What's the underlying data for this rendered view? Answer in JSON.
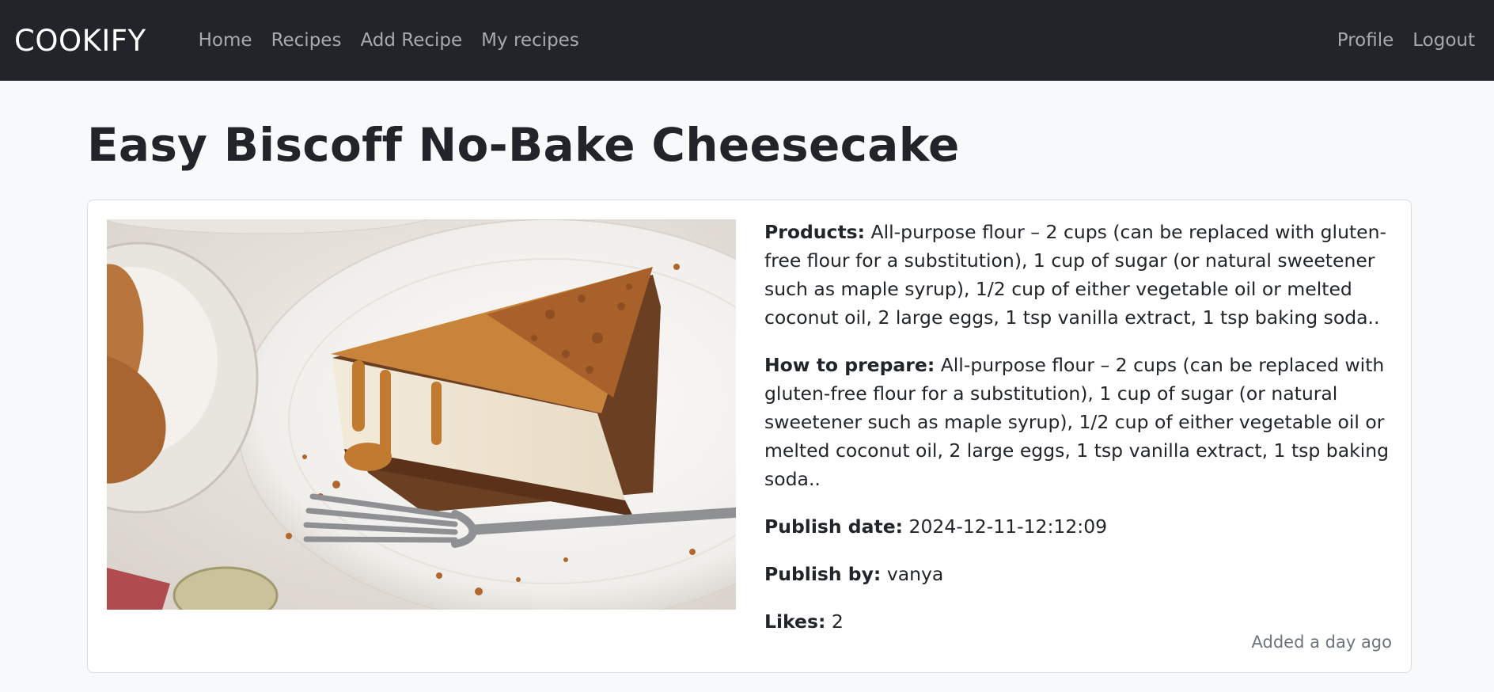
{
  "nav": {
    "brand": "COOKIFY",
    "links": [
      "Home",
      "Recipes",
      "Add Recipe",
      "My recipes"
    ],
    "right_links": [
      "Profile",
      "Logout"
    ]
  },
  "recipe": {
    "title": "Easy Biscoff No-Bake Cheesecake",
    "image_alt": "Slice of Biscoff cheesecake on a plate with a fork",
    "products_label": "Products:",
    "products": "All-purpose flour – 2 cups (can be replaced with gluten-free flour for a substitution), 1 cup of sugar (or natural sweetener such as maple syrup), 1/2 cup of either vegetable oil or melted coconut oil, 2 large eggs, 1 tsp vanilla extract, 1 tsp baking soda..",
    "prepare_label": "How to prepare:",
    "prepare": "All-purpose flour – 2 cups (can be replaced with gluten-free flour for a substitution), 1 cup of sugar (or natural sweetener such as maple syrup), 1/2 cup of either vegetable oil or melted coconut oil, 2 large eggs, 1 tsp vanilla extract, 1 tsp baking soda..",
    "publish_date_label": "Publish date:",
    "publish_date": "2024-12-11-12:12:09",
    "publish_by_label": "Publish by:",
    "publish_by": "vanya",
    "likes_label": "Likes:",
    "likes": "2",
    "added": "Added a day ago"
  }
}
